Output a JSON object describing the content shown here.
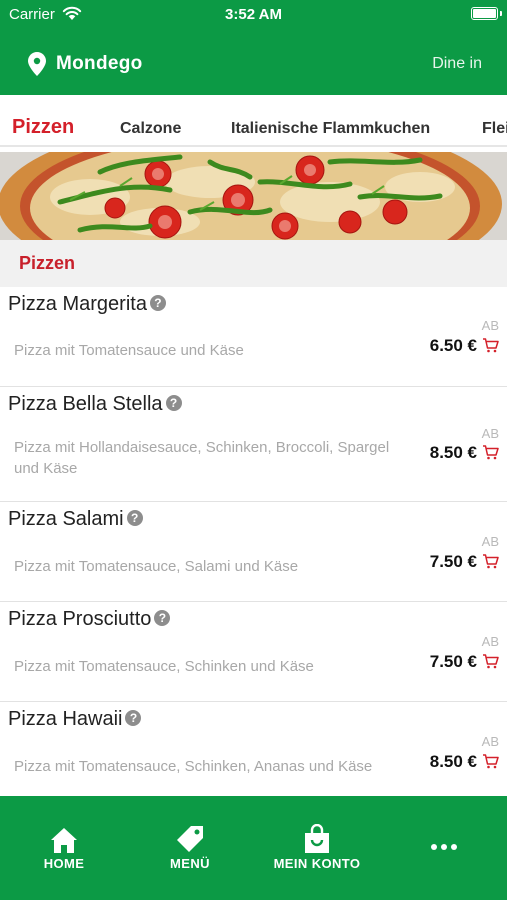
{
  "status_bar": {
    "carrier": "Carrier",
    "time": "3:52 AM"
  },
  "header": {
    "location": "Mondego",
    "service_mode": "Dine in"
  },
  "tabs": [
    {
      "label": "Pizzen",
      "active": true
    },
    {
      "label": "Calzone"
    },
    {
      "label": "Italienische Flammkuchen"
    },
    {
      "label": "Flei"
    }
  ],
  "section": {
    "title": "Pizzen"
  },
  "products": [
    {
      "name": "Pizza Margerita",
      "description": "Pizza mit Tomatensauce und Käse",
      "from": "AB",
      "price": "6.50 €"
    },
    {
      "name": "Pizza Bella Stella",
      "description": "Pizza mit Hollandaisesauce, Schinken, Broccoli, Spargel und Käse",
      "from": "AB",
      "price": "8.50 €"
    },
    {
      "name": "Pizza Salami",
      "description": "Pizza mit Tomatensauce, Salami und Käse",
      "from": "AB",
      "price": "7.50 €"
    },
    {
      "name": "Pizza Prosciutto",
      "description": "Pizza mit Tomatensauce, Schinken und Käse",
      "from": "AB",
      "price": "7.50 €"
    },
    {
      "name": "Pizza Hawaii",
      "description": "Pizza mit Tomatensauce, Schinken, Ananas und Käse",
      "from": "AB",
      "price": "8.50 €"
    }
  ],
  "bottom_nav": [
    {
      "label": "HOME",
      "icon": "home-icon"
    },
    {
      "label": "MENÜ",
      "icon": "tag-icon"
    },
    {
      "label": "MEIN KONTO",
      "icon": "shopping-bag-icon"
    },
    {
      "label": "",
      "icon": "more-icon"
    }
  ],
  "colors": {
    "brand_green": "#0c9a45",
    "accent_red": "#d4202a"
  }
}
